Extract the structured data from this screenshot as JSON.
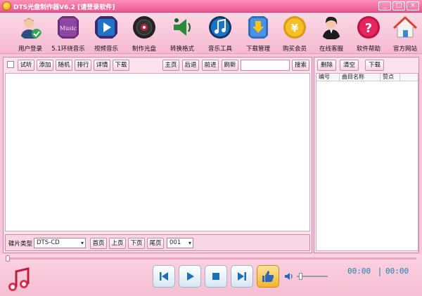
{
  "window": {
    "title": "DTS光盘制作器V6.2 [请登录软件]",
    "controls": [
      "_",
      "□",
      "×"
    ]
  },
  "toolbar": {
    "items": [
      {
        "label": "用户登录",
        "icon": "user-login-icon"
      },
      {
        "label": "5.1环绕音乐",
        "icon": "music-surround-icon"
      },
      {
        "label": "视频音乐",
        "icon": "video-music-icon"
      },
      {
        "label": "制作光盘",
        "icon": "disc-icon"
      },
      {
        "label": "转换格式",
        "icon": "convert-format-icon"
      },
      {
        "label": "音乐工具",
        "icon": "music-tools-icon"
      },
      {
        "label": "下载管理",
        "icon": "download-manager-icon"
      },
      {
        "label": "购买会员",
        "icon": "buy-member-icon"
      },
      {
        "label": "在线客服",
        "icon": "online-service-icon"
      },
      {
        "label": "软件帮助",
        "icon": "help-icon"
      },
      {
        "label": "官方网站",
        "icon": "home-icon"
      }
    ]
  },
  "left_panel": {
    "action_buttons": [
      "试听",
      "添加",
      "随机",
      "排行",
      "详情",
      "下载"
    ],
    "nav_buttons": [
      "主页",
      "后退",
      "前进",
      "刷新"
    ],
    "search": {
      "value": "",
      "placeholder": "",
      "button": "搜索"
    },
    "bottom": {
      "disc_type_label": "碟片类型",
      "disc_type_value": "DTS-CD",
      "page_buttons": [
        "首页",
        "上页",
        "下页",
        "尾页"
      ],
      "page_value": "001"
    }
  },
  "right_panel": {
    "buttons": [
      "删除",
      "清空",
      "下载"
    ],
    "columns": [
      "编号",
      "曲目名称",
      "赞点"
    ]
  },
  "player": {
    "time_current": "00:00",
    "time_total": "00:00",
    "colors": {
      "time": "#1f7fb4",
      "accent": "#e8588f"
    }
  }
}
